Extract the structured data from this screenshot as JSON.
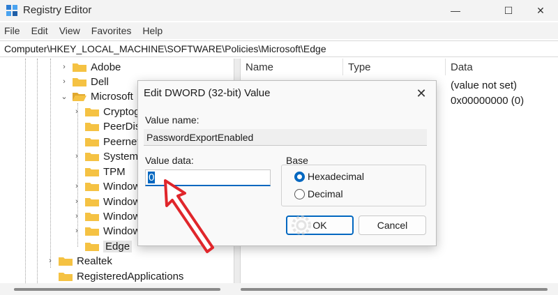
{
  "window": {
    "title": "Registry Editor",
    "minimize": "—",
    "maximize": "☐",
    "close": "✕"
  },
  "menu": [
    "File",
    "Edit",
    "View",
    "Favorites",
    "Help"
  ],
  "address": "Computer\\HKEY_LOCAL_MACHINE\\SOFTWARE\\Policies\\Microsoft\\Edge",
  "tree": {
    "items": [
      {
        "label": "Adobe",
        "chevron": "›"
      },
      {
        "label": "Dell",
        "chevron": "›"
      },
      {
        "label": "Microsoft",
        "chevron": "⌄"
      },
      {
        "label": "Cryptog",
        "chevron": "›"
      },
      {
        "label": "PeerDist",
        "chevron": ""
      },
      {
        "label": "Peernet",
        "chevron": ""
      },
      {
        "label": "SystemC",
        "chevron": "›"
      },
      {
        "label": "TPM",
        "chevron": ""
      },
      {
        "label": "Window",
        "chevron": "›"
      },
      {
        "label": "Window",
        "chevron": "›"
      },
      {
        "label": "Window",
        "chevron": "›"
      },
      {
        "label": "Window",
        "chevron": "›"
      },
      {
        "label": "Edge",
        "chevron": ""
      },
      {
        "label": "Realtek",
        "chevron": "›"
      },
      {
        "label": "RegisteredApplications",
        "chevron": ""
      }
    ]
  },
  "values_pane": {
    "columns": [
      "Name",
      "Type",
      "Data"
    ],
    "rows": [
      {
        "data": "(value not set)"
      },
      {
        "data": "0x00000000 (0)"
      }
    ]
  },
  "dialog": {
    "title": "Edit DWORD (32-bit) Value",
    "value_name_label": "Value name:",
    "value_name": "PasswordExportEnabled",
    "value_data_label": "Value data:",
    "value_data": "0",
    "base_label": "Base",
    "radio_hex": "Hexadecimal",
    "radio_dec": "Decimal",
    "ok": "OK",
    "cancel": "Cancel",
    "close": "✕",
    "selected_base": "Hexadecimal"
  },
  "watermark": "Quantrimang",
  "colors": {
    "accent": "#0067c0",
    "folder": "#f5c243",
    "annotation_arrow": "#e0262b"
  }
}
